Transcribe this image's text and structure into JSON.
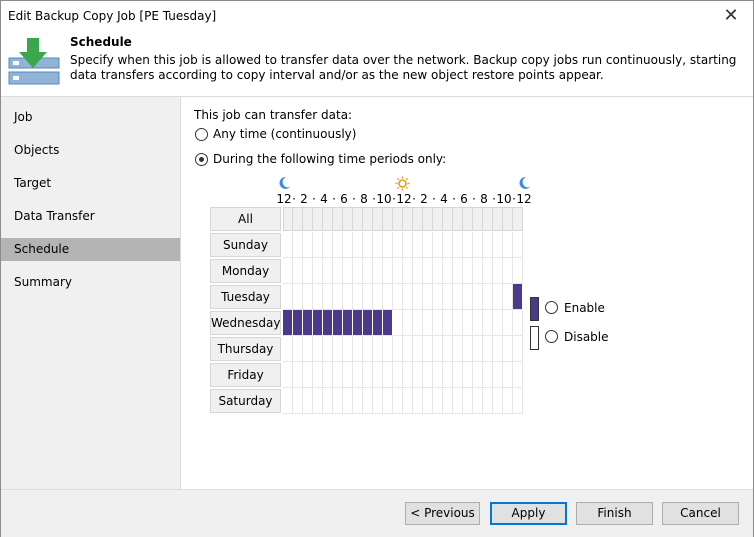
{
  "window": {
    "title": "Edit Backup Copy Job [PE Tuesday]",
    "close_glyph": "✕"
  },
  "header": {
    "title": "Schedule",
    "description": "Specify when this job is allowed to transfer data over the network. Backup copy jobs run continuously, starting data transfers according to copy interval and/or as the new object restore points appear.",
    "icon": "schedule-download-icon"
  },
  "sidebar": {
    "items": [
      {
        "label": "Job",
        "active": false
      },
      {
        "label": "Objects",
        "active": false
      },
      {
        "label": "Target",
        "active": false
      },
      {
        "label": "Data Transfer",
        "active": false
      },
      {
        "label": "Schedule",
        "active": true
      },
      {
        "label": "Summary",
        "active": false
      }
    ]
  },
  "main": {
    "transfer_label": "This job can transfer data:",
    "option_any": "Any time (continuously)",
    "option_periods": "During the following time periods only:",
    "selected_option": "periods"
  },
  "grid": {
    "all_label": "All",
    "hour_labels": [
      "12",
      "·",
      "2",
      "·",
      "4",
      "·",
      "6",
      "·",
      "8",
      "·",
      "10",
      "·",
      "12",
      "·",
      "2",
      "·",
      "4",
      "·",
      "6",
      "·",
      "8",
      "·",
      "10",
      "·",
      "12"
    ],
    "days": [
      "Sunday",
      "Monday",
      "Tuesday",
      "Wednesday",
      "Thursday",
      "Friday",
      "Saturday"
    ],
    "enabled_hours": {
      "Tuesday": [
        23
      ],
      "Wednesday": [
        0,
        1,
        2,
        3,
        4,
        5,
        6,
        7,
        8,
        9,
        10
      ]
    },
    "colors": {
      "enabled": "#4b3a8c",
      "moon": "#3a8fd6",
      "sun": "#e0a020"
    }
  },
  "legend": {
    "enable_label": "Enable",
    "disable_label": "Disable",
    "selected": "none"
  },
  "footer": {
    "previous": "< Previous",
    "apply": "Apply",
    "finish": "Finish",
    "cancel": "Cancel"
  }
}
